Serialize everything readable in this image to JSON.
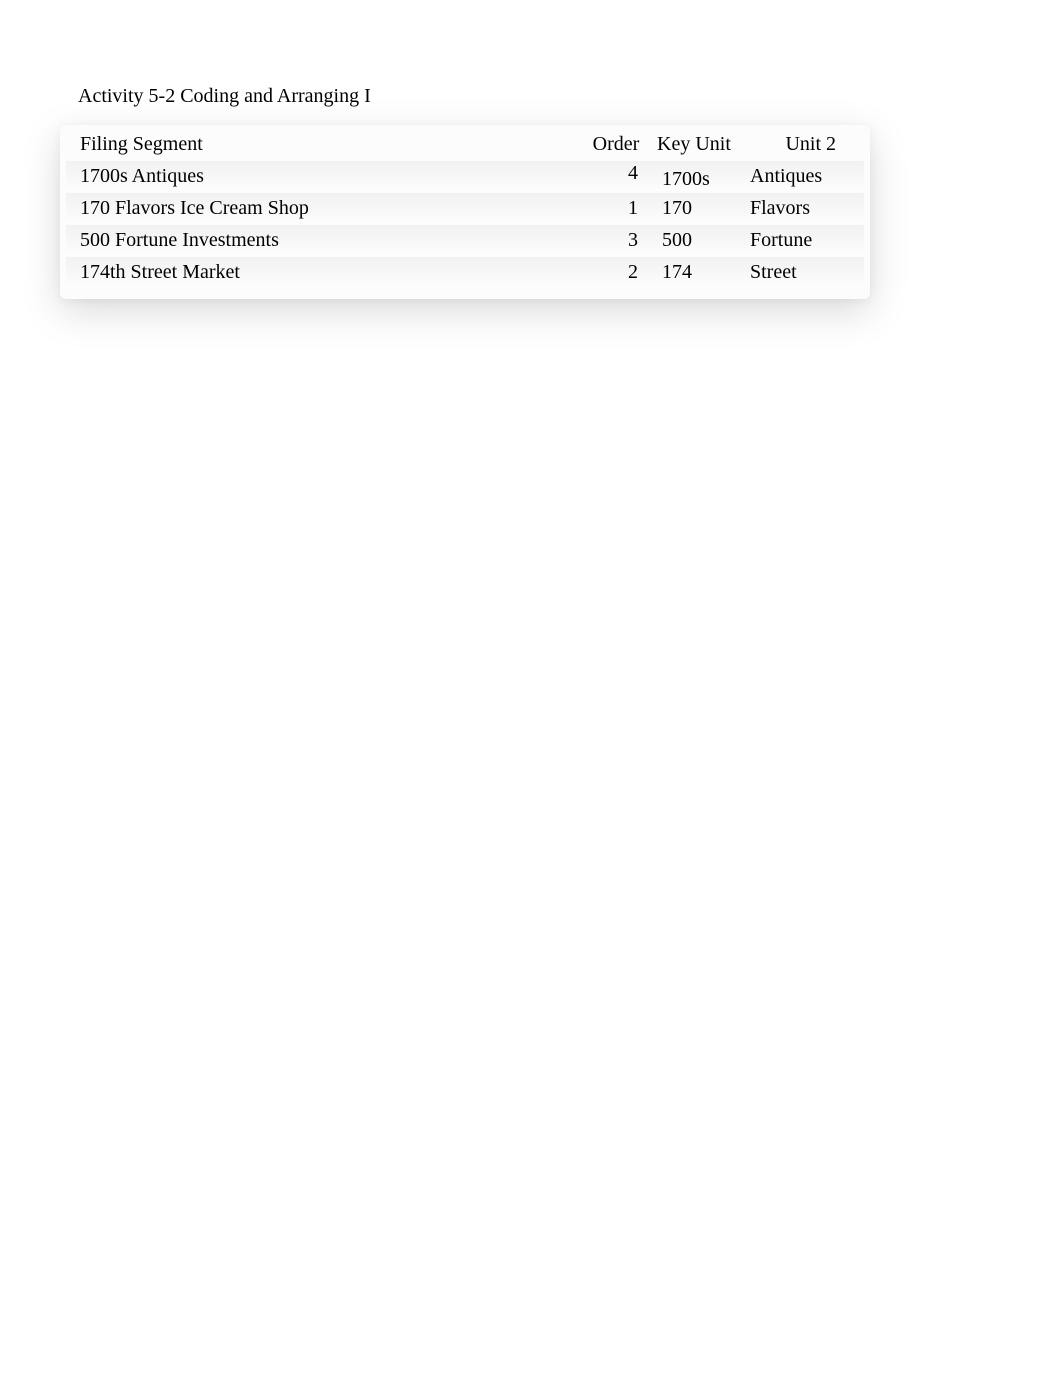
{
  "title": "Activity 5-2 Coding and Arranging I",
  "table": {
    "headers": {
      "filing_segment": "Filing Segment",
      "order": "Order",
      "key_unit": "Key Unit",
      "unit2": "Unit 2"
    },
    "rows": [
      {
        "filing_segment": "1700s Antiques",
        "order": "4",
        "key_unit": "1700s",
        "unit2": "Antiques"
      },
      {
        "filing_segment": "170 Flavors Ice Cream Shop",
        "order": "1",
        "key_unit": "170",
        "unit2": "Flavors"
      },
      {
        "filing_segment": "500 Fortune Investments",
        "order": "3",
        "key_unit": "500",
        "unit2": "Fortune"
      },
      {
        "filing_segment": "174th Street Market",
        "order": "2",
        "key_unit": "174",
        "unit2": "Street"
      }
    ]
  }
}
